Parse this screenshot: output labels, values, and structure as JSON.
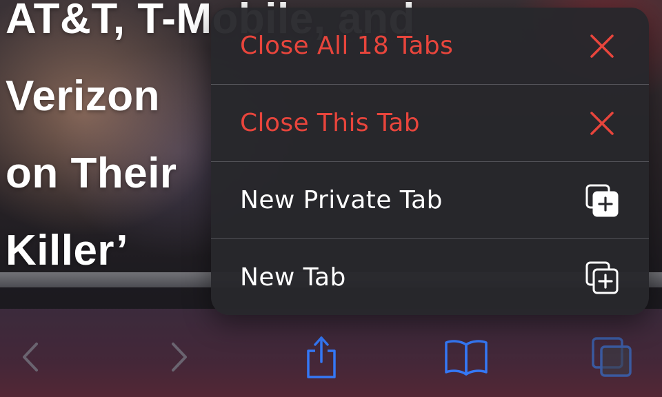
{
  "background": {
    "headline_lines": [
      "AT&T, T-Mobile, and",
      "Verizon",
      "on Their",
      "Killer’"
    ]
  },
  "menu": {
    "items": [
      {
        "label": "Close All 18 Tabs",
        "icon": "close-icon",
        "style": "destructive"
      },
      {
        "label": "Close This Tab",
        "icon": "close-icon",
        "style": "destructive"
      },
      {
        "label": "New Private Tab",
        "icon": "new-private-tab-icon",
        "style": "normal"
      },
      {
        "label": "New Tab",
        "icon": "new-tab-icon",
        "style": "normal"
      }
    ]
  },
  "toolbar": {
    "buttons": [
      {
        "icon": "back-chevron-icon",
        "enabled": false
      },
      {
        "icon": "forward-chevron-icon",
        "enabled": false
      },
      {
        "icon": "share-icon",
        "enabled": true
      },
      {
        "icon": "bookmarks-book-icon",
        "enabled": true
      },
      {
        "icon": "tabs-icon",
        "enabled": true
      }
    ]
  },
  "colors": {
    "destructive": "#e8453c",
    "accent": "#3478f6",
    "menu_background": "#28282c",
    "disabled": "#6a6470"
  }
}
